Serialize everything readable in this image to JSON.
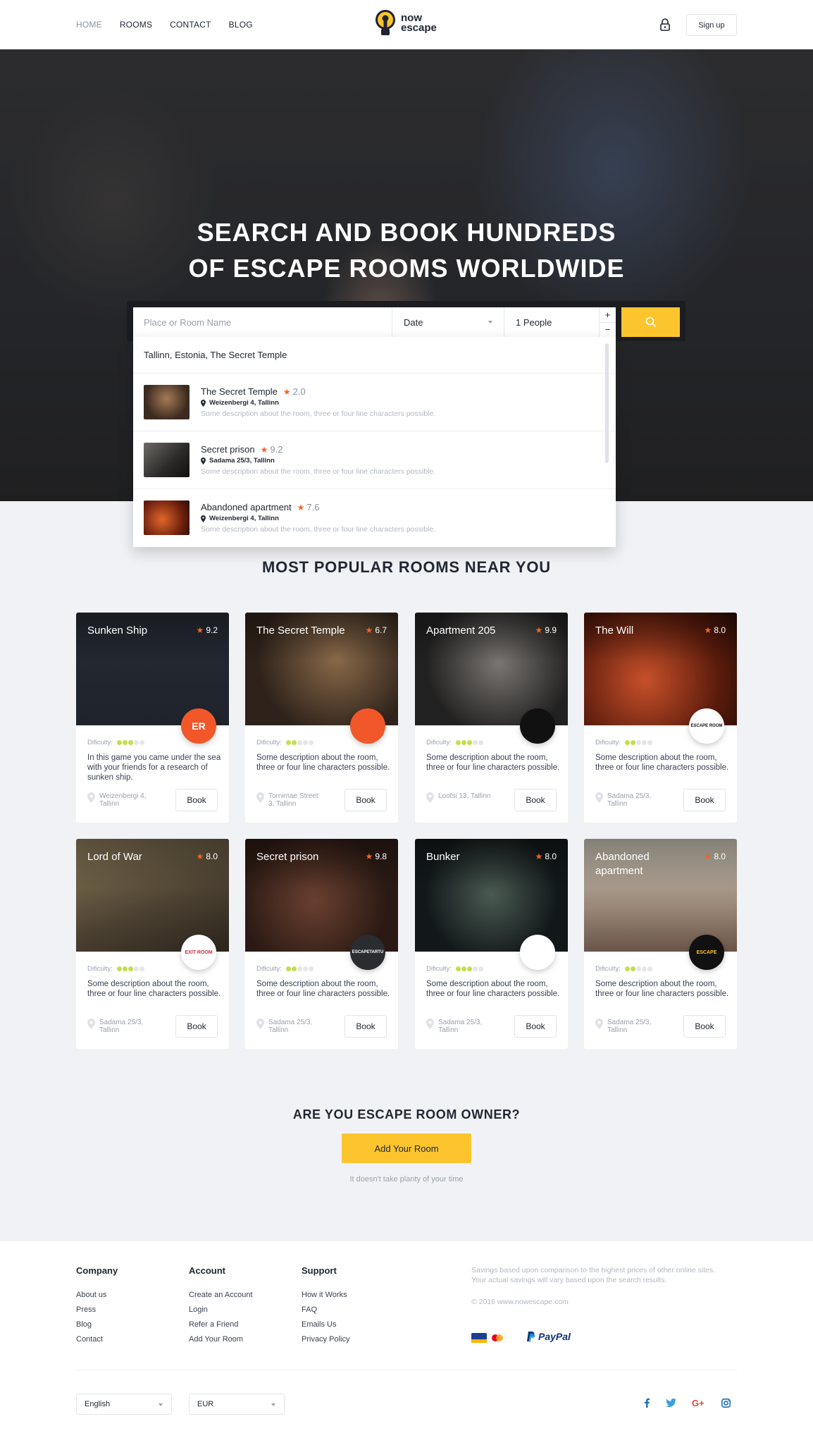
{
  "nav": {
    "items": [
      "HOME",
      "ROOMS",
      "CONTACT",
      "BLOG"
    ],
    "logo_line1": "now",
    "logo_line2": "escape",
    "signup": "Sign up"
  },
  "hero": {
    "title_line1": "SEARCH AND BOOK HUNDREDS",
    "title_line2": "OF ESCAPE ROOMS WORLDWIDE"
  },
  "search": {
    "placeholder": "Place or Room Name",
    "date": "Date",
    "people": "1 People",
    "plus": "+",
    "minus": "−"
  },
  "dropdown": {
    "header": "Tallinn, Estonia, The Secret Temple",
    "items": [
      {
        "name": "The Secret Temple",
        "rating": "2.0",
        "address": "Weizenbergi 4, Tallinn",
        "desc": "Some description about the room,  three or four line characters possible."
      },
      {
        "name": "Secret prison",
        "rating": "9.2",
        "address": "Sadama 25/3, Tallinn",
        "desc": "Some description about the room,  three or four line characters possible."
      },
      {
        "name": "Abandoned apartment",
        "rating": "7.6",
        "address": "Weizenbergi 4, Tallinn",
        "desc": "Some description about the room,  three or four line characters possible."
      }
    ]
  },
  "popular": {
    "title": "MOST POPULAR ROOMS NEAR YOU",
    "difficulty_label": "Dificulty:",
    "book_label": "Book",
    "rooms": [
      {
        "name": "Sunken Ship",
        "rating": "9.2",
        "badge": "ER",
        "difficulty": 3,
        "desc": "In this game you came under the sea with your friends for a research of sunken ship.",
        "location": "Weizenbergi 4, Tallinn"
      },
      {
        "name": "The Secret Temple",
        "rating": "6.7",
        "badge": "",
        "difficulty": 2,
        "desc": "Some description about the room, three or four line characters possible.",
        "location": "Tornimae Street 3, Tallinn"
      },
      {
        "name": "Apartment 205",
        "rating": "9.9",
        "badge": "",
        "difficulty": 3,
        "desc": "Some description about the room, three or four line characters possible.",
        "location": "Lootsi 13, Tallinn"
      },
      {
        "name": "The Will",
        "rating": "8.0",
        "badge": "ESCAPE ROOM",
        "difficulty": 2,
        "desc": "Some description about the room, three or four line characters possible.",
        "location": "Sadama 25/3, Tallinn"
      },
      {
        "name": "Lord of War",
        "rating": "8.0",
        "badge": "EXIT ROOM",
        "difficulty": 3,
        "desc": "Some description about the room, three or four line characters possible.",
        "location": "Sadama 25/3, Tallinn"
      },
      {
        "name": "Secret prison",
        "rating": "9.8",
        "badge": "ESCAPETARTU",
        "difficulty": 2,
        "desc": "Some description about the room, three or four line characters possible.",
        "location": "Sadama 25/3, Tallinn"
      },
      {
        "name": "Bunker",
        "rating": "8.0",
        "badge": "",
        "difficulty": 3,
        "desc": "Some description about the room, three or four line characters possible.",
        "location": "Sadama 25/3, Tallinn"
      },
      {
        "name": "Abandoned apartment",
        "rating": "8.0",
        "badge": "ESCAPE",
        "difficulty": 2,
        "desc": "Some description about the room, three or four line characters possible.",
        "location": "Sadama 25/3, Tallinn"
      }
    ]
  },
  "owner": {
    "title": "ARE YOU ESCAPE ROOM OWNER?",
    "button": "Add Your Room",
    "note": "It doesn't take planty of your time"
  },
  "footer": {
    "company": {
      "title": "Company",
      "links": [
        "About us",
        "Press",
        "Blog",
        "Contact"
      ]
    },
    "account": {
      "title": "Account",
      "links": [
        "Create an Account",
        "Login",
        "Refer a Friend",
        "Add Your Room"
      ]
    },
    "support": {
      "title": "Support",
      "links": [
        "How it Works",
        "FAQ",
        "Emails Us",
        "Privacy Policy"
      ]
    },
    "note": "Savings based upon comparison to the highest prices of other online sites. Your actual savings will vary based upon the search results.",
    "copyright": "© 2016 www.nowescape.com",
    "paypal": "PayPal",
    "language": "English",
    "currency": "EUR",
    "socials": [
      "f",
      "t",
      "G+",
      "ig"
    ]
  },
  "colors": {
    "accent": "#fcc52e",
    "star": "#f26522",
    "text": "#222833",
    "muted": "#9aa1ad"
  }
}
